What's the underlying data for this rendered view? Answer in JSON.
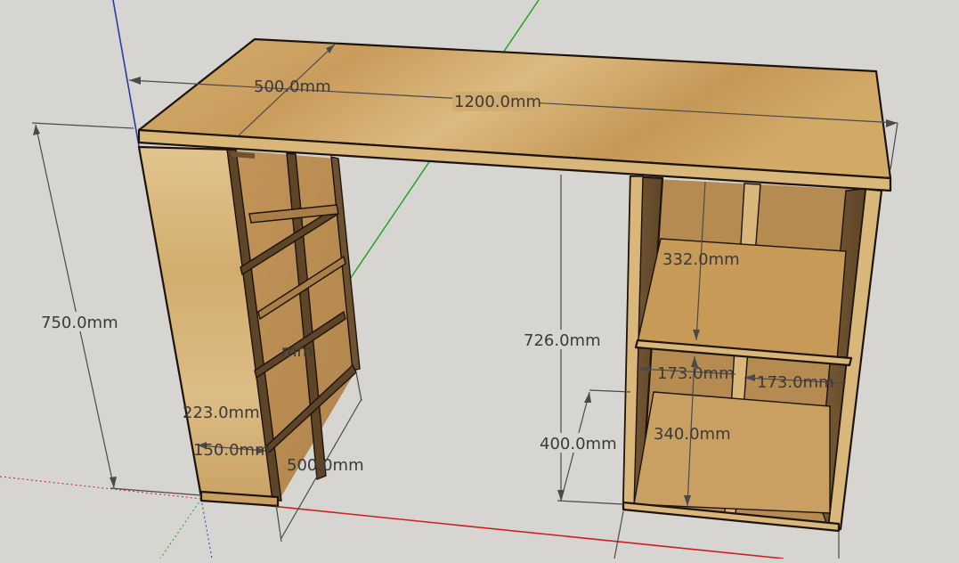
{
  "colors": {
    "background": "#d6d5d1",
    "wood_light": "#d9b679",
    "wood_mid": "#c79a58",
    "wood_dark": "#6e5230",
    "axis_red": "#cc1f1f",
    "axis_green": "#1aa01a",
    "axis_blue": "#2a3aa8"
  },
  "dimensions": {
    "depth_top": "500.0mm",
    "width_top": "1200.0mm",
    "height_total": "750.0mm",
    "left_partial_mm": "mm",
    "left_partial_223": "223.0mm",
    "left_150": "150.0mm",
    "left_depth": "500.0mm",
    "right_inner_height": "726.0mm",
    "right_upper_shelf": "332.0mm",
    "right_cell_left": "173.0mm",
    "right_cell_right": "173.0mm",
    "right_lower_shelf": "340.0mm",
    "right_base_height": "400.0mm"
  }
}
